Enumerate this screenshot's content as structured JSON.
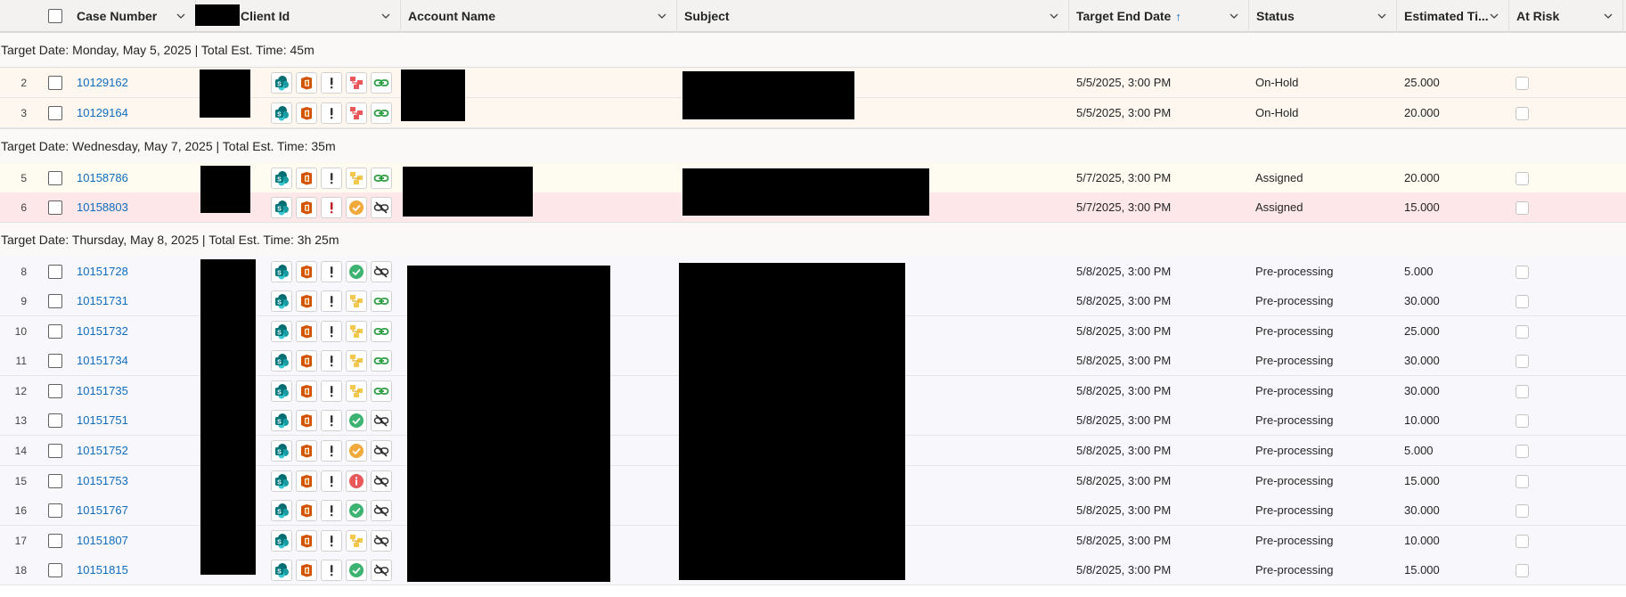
{
  "columns": {
    "case_number": "Case Number",
    "client_id": "Client Id",
    "account_name": "Account Name",
    "subject": "Subject",
    "target_end_date": "Target End Date",
    "status": "Status",
    "estimated_time": "Estimated Ti...",
    "at_risk": "At Risk"
  },
  "sort": {
    "column": "target_end_date",
    "direction": "ascending"
  },
  "colors": {
    "link": "#0f6cbd",
    "row_onhold": "#fdf7f0",
    "row_assigned": "#fefcf1",
    "row_alert": "#fde7e9",
    "row_preprocessing": "#f8f7fc",
    "group_bg": "#faf9f8"
  },
  "groups": [
    {
      "label": "Target Date: Monday, May 5, 2025 | Total Est. Time: 45m",
      "rows": [
        {
          "num": "2",
          "case": "10129162",
          "icons": [
            "sharepoint-icon",
            "office-icon",
            "exclamation-icon",
            "org-chart-red-icon",
            "link-green-icon"
          ],
          "target_end_date": "5/5/2025, 3:00 PM",
          "status": "On-Hold",
          "est": "25.000",
          "tone": "onhold"
        },
        {
          "num": "3",
          "case": "10129164",
          "icons": [
            "sharepoint-icon",
            "office-icon",
            "exclamation-icon",
            "org-chart-red-icon",
            "link-green-icon"
          ],
          "target_end_date": "5/5/2025, 3:00 PM",
          "status": "On-Hold",
          "est": "20.000",
          "tone": "onhold"
        }
      ]
    },
    {
      "label": "Target Date: Wednesday, May 7, 2025 | Total Est. Time: 35m",
      "rows": [
        {
          "num": "5",
          "case": "10158786",
          "icons": [
            "sharepoint-icon",
            "office-icon",
            "exclamation-icon",
            "org-chart-yellow-icon",
            "link-green-icon"
          ],
          "target_end_date": "5/7/2025, 3:00 PM",
          "status": "Assigned",
          "est": "20.000",
          "tone": "assigned"
        },
        {
          "num": "6",
          "case": "10158803",
          "icons": [
            "sharepoint-icon",
            "office-icon",
            "exclamation-red-icon",
            "check-orange-icon",
            "link-broken-icon"
          ],
          "target_end_date": "5/7/2025, 3:00 PM",
          "status": "Assigned",
          "est": "15.000",
          "tone": "alert"
        }
      ]
    },
    {
      "label": "Target Date: Thursday, May 8, 2025 | Total Est. Time: 3h 25m",
      "rows": [
        {
          "num": "8",
          "case": "10151728",
          "icons": [
            "sharepoint-icon",
            "office-icon",
            "exclamation-icon",
            "check-green-icon",
            "link-broken-icon"
          ],
          "target_end_date": "5/8/2025, 3:00 PM",
          "status": "Pre-processing",
          "est": "5.000",
          "tone": "pre"
        },
        {
          "num": "9",
          "case": "10151731",
          "icons": [
            "sharepoint-icon",
            "office-icon",
            "exclamation-icon",
            "org-chart-yellow-icon",
            "link-green-icon"
          ],
          "target_end_date": "5/8/2025, 3:00 PM",
          "status": "Pre-processing",
          "est": "30.000",
          "tone": "pre"
        },
        {
          "num": "10",
          "case": "10151732",
          "icons": [
            "sharepoint-icon",
            "office-icon",
            "exclamation-icon",
            "org-chart-yellow-icon",
            "link-green-icon"
          ],
          "target_end_date": "5/8/2025, 3:00 PM",
          "status": "Pre-processing",
          "est": "25.000",
          "tone": "pre"
        },
        {
          "num": "11",
          "case": "10151734",
          "icons": [
            "sharepoint-icon",
            "office-icon",
            "exclamation-icon",
            "org-chart-yellow-icon",
            "link-green-icon"
          ],
          "target_end_date": "5/8/2025, 3:00 PM",
          "status": "Pre-processing",
          "est": "30.000",
          "tone": "pre"
        },
        {
          "num": "12",
          "case": "10151735",
          "icons": [
            "sharepoint-icon",
            "office-icon",
            "exclamation-icon",
            "org-chart-yellow-icon",
            "link-green-icon"
          ],
          "target_end_date": "5/8/2025, 3:00 PM",
          "status": "Pre-processing",
          "est": "30.000",
          "tone": "pre"
        },
        {
          "num": "13",
          "case": "10151751",
          "icons": [
            "sharepoint-icon",
            "office-icon",
            "exclamation-icon",
            "check-green-icon",
            "link-broken-icon"
          ],
          "target_end_date": "5/8/2025, 3:00 PM",
          "status": "Pre-processing",
          "est": "10.000",
          "tone": "pre"
        },
        {
          "num": "14",
          "case": "10151752",
          "icons": [
            "sharepoint-icon",
            "office-icon",
            "exclamation-icon",
            "check-orange-icon",
            "link-broken-icon"
          ],
          "target_end_date": "5/8/2025, 3:00 PM",
          "status": "Pre-processing",
          "est": "5.000",
          "tone": "pre"
        },
        {
          "num": "15",
          "case": "10151753",
          "icons": [
            "sharepoint-icon",
            "office-icon",
            "exclamation-icon",
            "info-red-icon",
            "link-broken-icon"
          ],
          "target_end_date": "5/8/2025, 3:00 PM",
          "status": "Pre-processing",
          "est": "15.000",
          "tone": "pre"
        },
        {
          "num": "16",
          "case": "10151767",
          "icons": [
            "sharepoint-icon",
            "office-icon",
            "exclamation-icon",
            "check-green-icon",
            "link-broken-icon"
          ],
          "target_end_date": "5/8/2025, 3:00 PM",
          "status": "Pre-processing",
          "est": "30.000",
          "tone": "pre"
        },
        {
          "num": "17",
          "case": "10151807",
          "icons": [
            "sharepoint-icon",
            "office-icon",
            "exclamation-icon",
            "org-chart-yellow-icon",
            "link-broken-icon"
          ],
          "target_end_date": "5/8/2025, 3:00 PM",
          "status": "Pre-processing",
          "est": "10.000",
          "tone": "pre"
        },
        {
          "num": "18",
          "case": "10151815",
          "icons": [
            "sharepoint-icon",
            "office-icon",
            "exclamation-icon",
            "check-green-icon",
            "link-broken-icon"
          ],
          "target_end_date": "5/8/2025, 3:00 PM",
          "status": "Pre-processing",
          "est": "15.000",
          "tone": "pre"
        }
      ]
    }
  ]
}
